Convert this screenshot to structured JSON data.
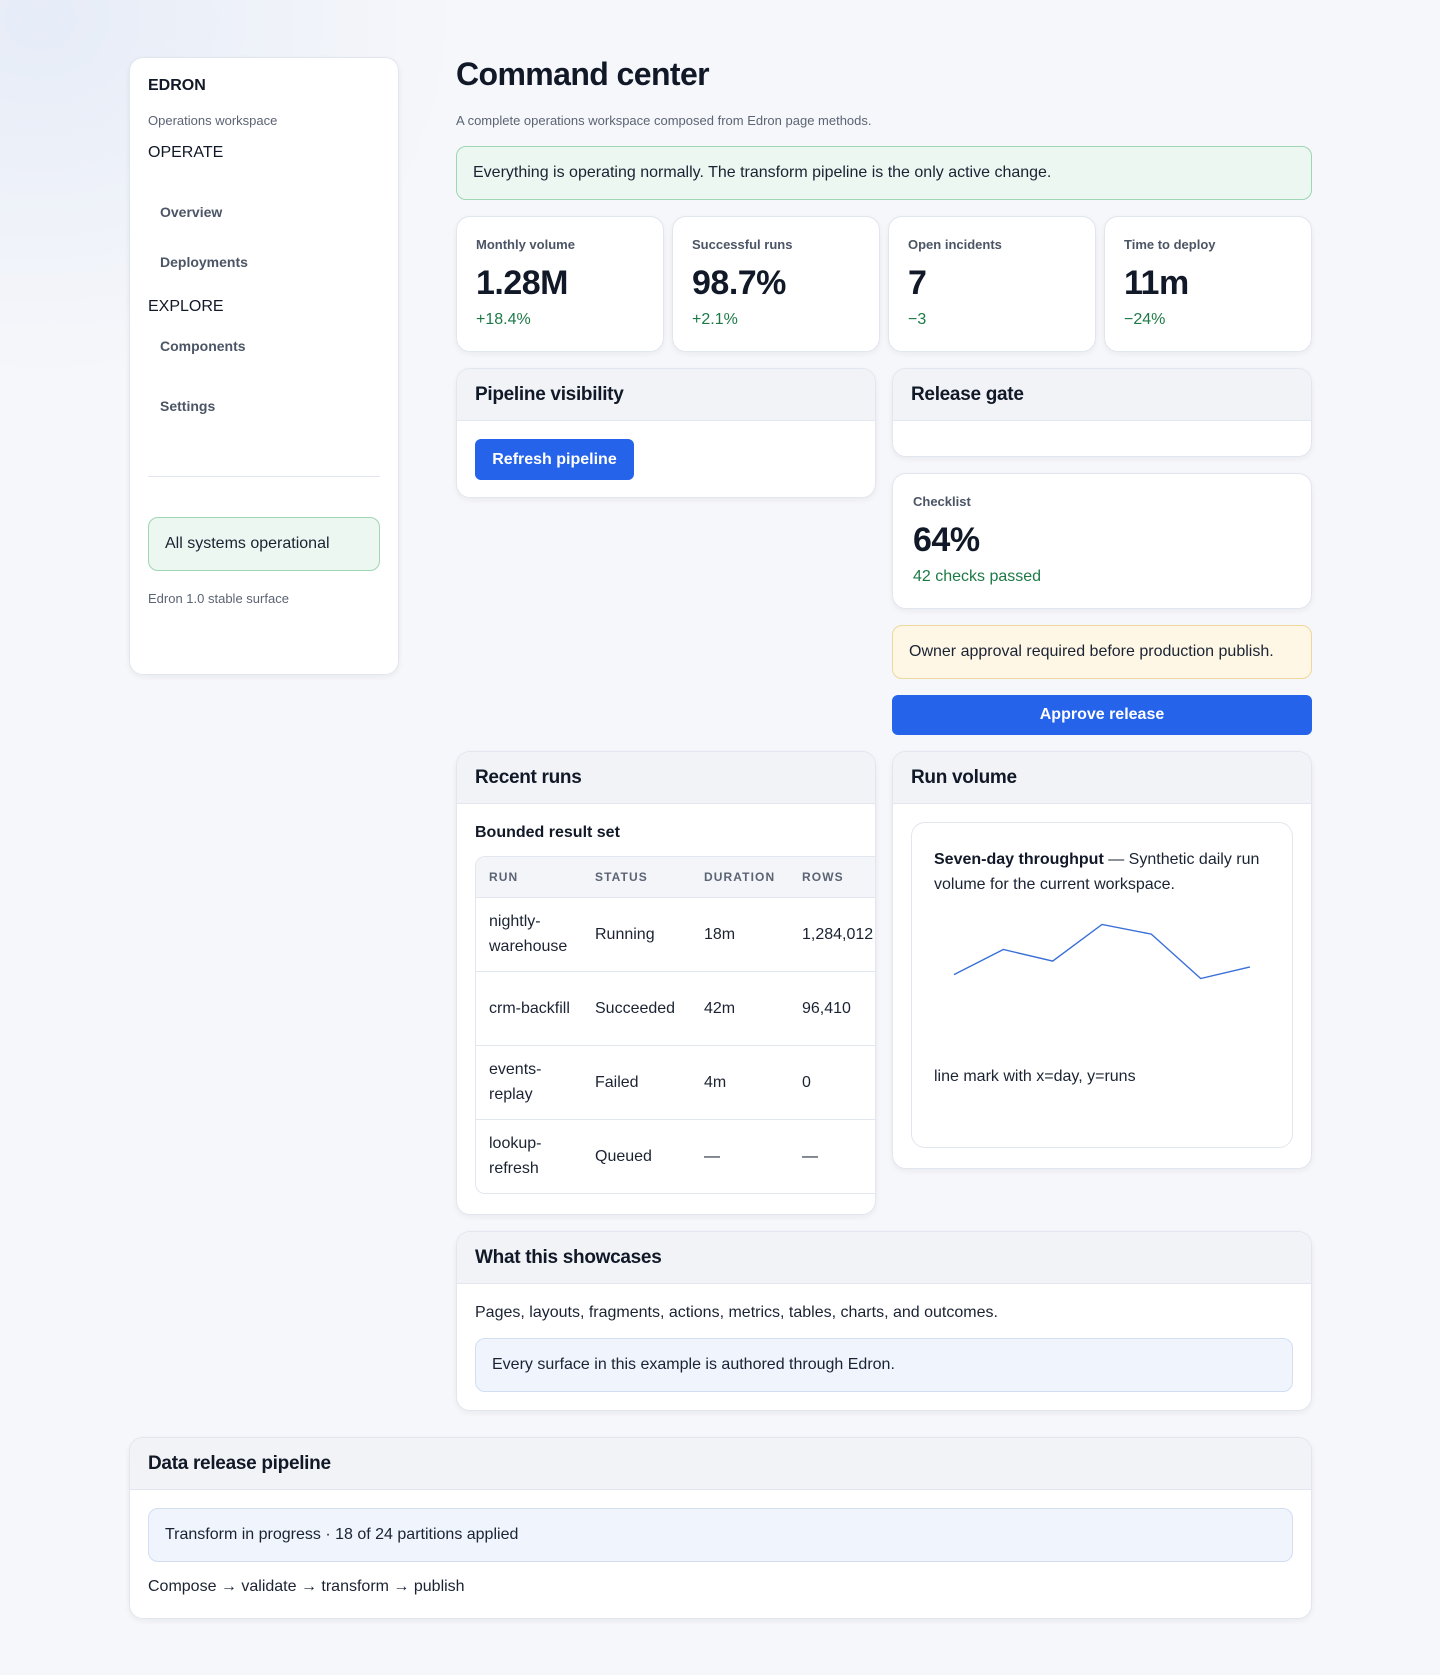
{
  "sidebar": {
    "brand": "EDRON",
    "subtitle": "Operations workspace",
    "groups": [
      {
        "label": "OPERATE",
        "items": [
          {
            "label": "Overview"
          },
          {
            "label": "Deployments"
          }
        ]
      },
      {
        "label": "EXPLORE",
        "items": [
          {
            "label": "Components"
          },
          {
            "label": "Settings"
          }
        ]
      }
    ],
    "status": "All systems operational",
    "footer": "Edron 1.0 stable surface"
  },
  "header": {
    "title": "Command center",
    "subtitle": "A complete operations workspace composed from Edron page methods."
  },
  "banner": "Everything is operating normally. The transform pipeline is the only active change.",
  "metrics": [
    {
      "label": "Monthly volume",
      "value": "1.28M",
      "delta": "+18.4%"
    },
    {
      "label": "Successful runs",
      "value": "98.7%",
      "delta": "+2.1%"
    },
    {
      "label": "Open incidents",
      "value": "7",
      "delta": "−3"
    },
    {
      "label": "Time to deploy",
      "value": "11m",
      "delta": "−24%"
    }
  ],
  "pipeline_panel": {
    "title": "Pipeline visibility",
    "button": "Refresh pipeline"
  },
  "release_gate": {
    "title": "Release gate",
    "checklist_label": "Checklist",
    "checklist_value": "64%",
    "checklist_note": "42 checks passed",
    "warning": "Owner approval required before production publish.",
    "approve_button": "Approve release"
  },
  "recent_runs": {
    "title": "Recent runs",
    "subtitle": "Bounded result set",
    "columns": [
      "RUN",
      "STATUS",
      "DURATION",
      "ROWS"
    ],
    "rows": [
      {
        "run": "nightly-warehouse",
        "status": "Running",
        "duration": "18m",
        "rows": "1,284,012"
      },
      {
        "run": "crm-backfill",
        "status": "Succeeded",
        "duration": "42m",
        "rows": "96,410"
      },
      {
        "run": "events-replay",
        "status": "Failed",
        "duration": "4m",
        "rows": "0"
      },
      {
        "run": "lookup-refresh",
        "status": "Queued",
        "duration": "—",
        "rows": "—"
      }
    ]
  },
  "run_volume": {
    "title": "Run volume",
    "caption_title": "Seven-day throughput",
    "caption_text": " — Synthetic daily run volume for the current workspace.",
    "footnote": "line mark with x=day, y=runs"
  },
  "chart_data": {
    "type": "line",
    "x": [
      1,
      2,
      3,
      4,
      5,
      6,
      7
    ],
    "values": [
      42,
      55,
      49,
      68,
      63,
      40,
      46
    ],
    "ylim": [
      20,
      75
    ],
    "color": "#3a6fd8"
  },
  "showcase": {
    "title": "What this showcases",
    "text": "Pages, layouts, fragments, actions, metrics, tables, charts, and outcomes.",
    "note": "Every surface in this example is authored through Edron."
  },
  "release_pipeline": {
    "title": "Data release pipeline",
    "status": "Transform in progress · 18 of 24 partitions applied",
    "flow": "Compose → validate → transform → publish"
  }
}
